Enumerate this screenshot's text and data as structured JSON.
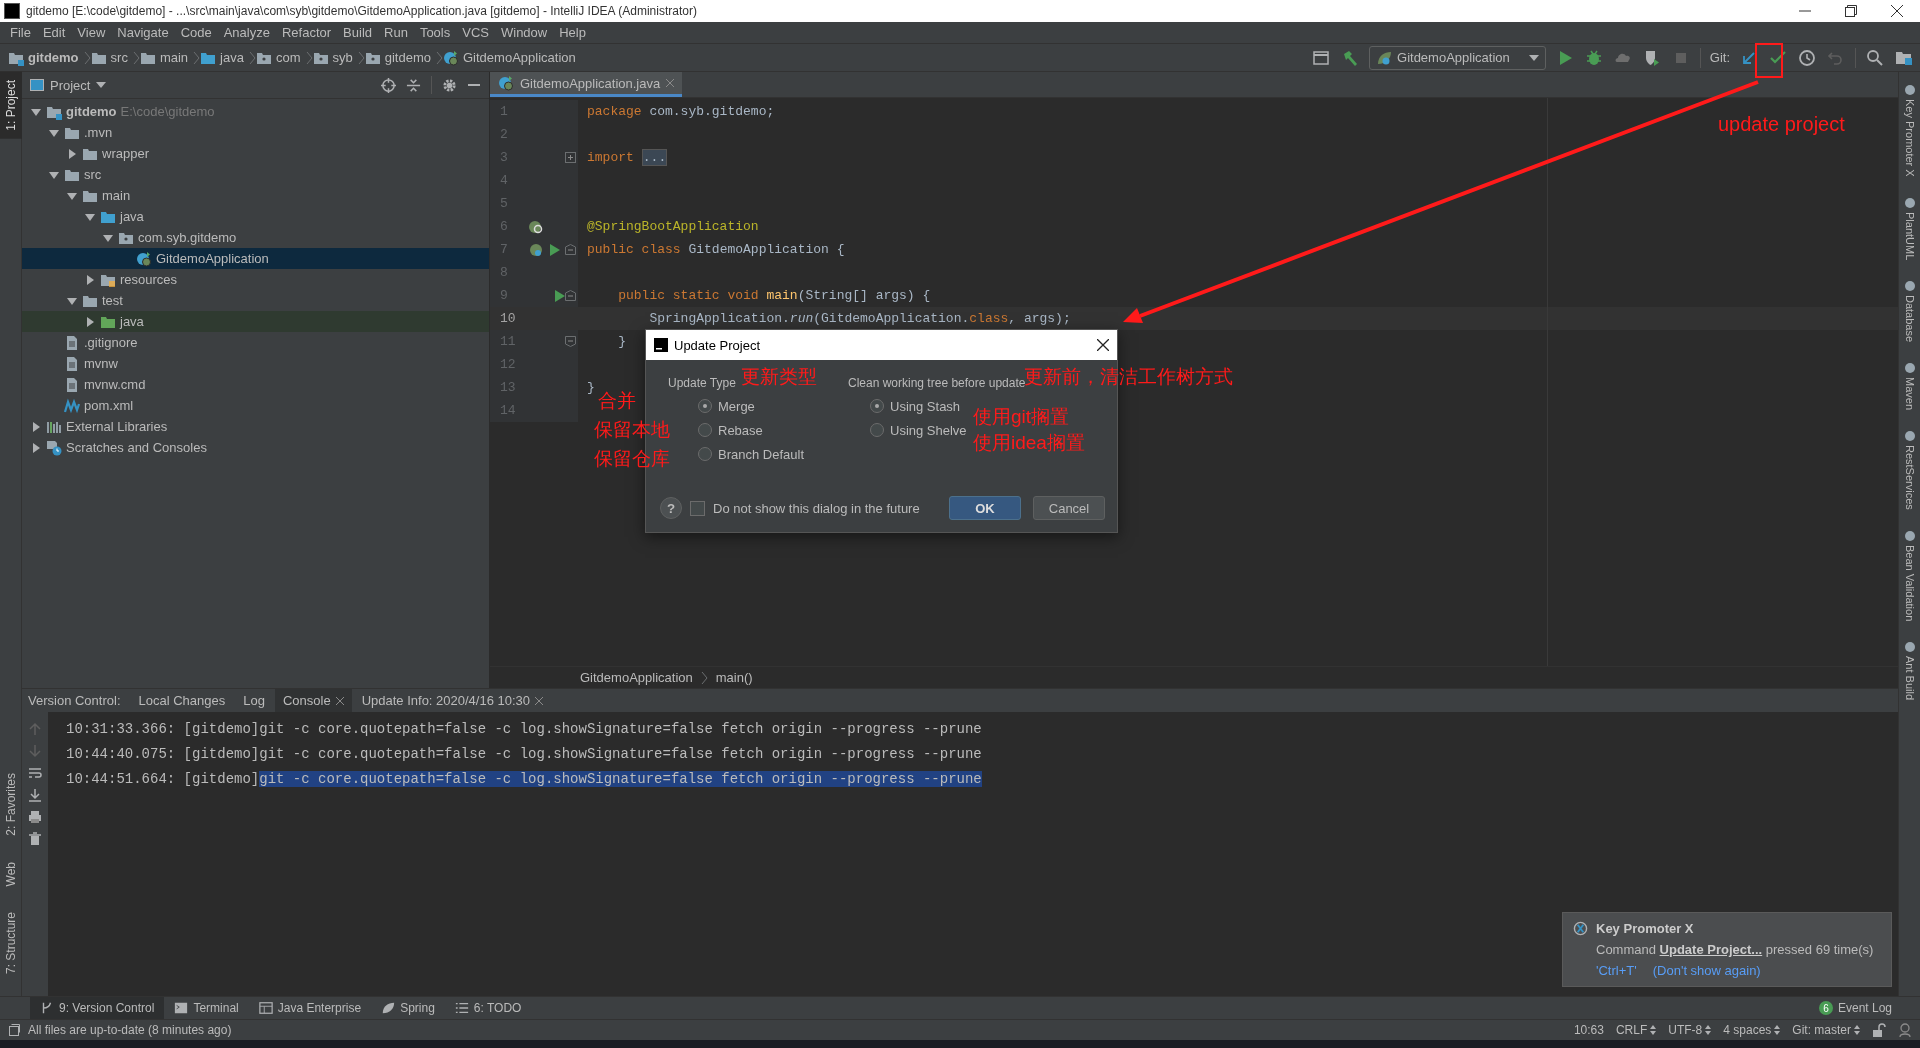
{
  "title_bar": {
    "title": "gitdemo [E:\\code\\gitdemo] - ...\\src\\main\\java\\com\\syb\\gitdemo\\GitdemoApplication.java [gitdemo] - IntelliJ IDEA (Administrator)"
  },
  "menu": [
    "File",
    "Edit",
    "View",
    "Navigate",
    "Code",
    "Analyze",
    "Refactor",
    "Build",
    "Run",
    "Tools",
    "VCS",
    "Window",
    "Help"
  ],
  "nav_bar": {
    "breadcrumbs": [
      {
        "label": "gitdemo",
        "kind": "module"
      },
      {
        "label": "src",
        "kind": "folder"
      },
      {
        "label": "main",
        "kind": "folder"
      },
      {
        "label": "java",
        "kind": "source-folder"
      },
      {
        "label": "com",
        "kind": "package"
      },
      {
        "label": "syb",
        "kind": "package"
      },
      {
        "label": "gitdemo",
        "kind": "package"
      },
      {
        "label": "GitdemoApplication",
        "kind": "spring-class"
      }
    ],
    "run_config": "GitdemoApplication",
    "vcs_label": "Git:"
  },
  "left_strip": [
    {
      "label": "1: Project",
      "selected": true
    },
    {
      "label": "2: Favorites",
      "selected": false
    },
    {
      "label": "Web",
      "selected": false
    },
    {
      "label": "7: Structure",
      "selected": false
    }
  ],
  "right_strip": [
    "Key Promoter X",
    "PlantUML",
    "Database",
    "Maven",
    "RestServices",
    "Bean Validation",
    "Ant Build"
  ],
  "project_panel": {
    "title": "Project",
    "tree": [
      {
        "label": "gitdemo",
        "kind": "module",
        "hint": "E:\\code\\gitdemo",
        "expanded": true,
        "selected": false,
        "children": [
          {
            "label": ".mvn",
            "kind": "folder",
            "expanded": true,
            "selected": false,
            "children": [
              {
                "label": "wrapper",
                "kind": "folder",
                "expanded": false,
                "selected": false
              }
            ]
          },
          {
            "label": "src",
            "kind": "folder",
            "expanded": true,
            "selected": false,
            "children": [
              {
                "label": "main",
                "kind": "folder",
                "expanded": true,
                "selected": false,
                "children": [
                  {
                    "label": "java",
                    "kind": "source-folder",
                    "expanded": true,
                    "selected": false,
                    "children": [
                      {
                        "label": "com.syb.gitdemo",
                        "kind": "package",
                        "expanded": true,
                        "selected": false,
                        "children": [
                          {
                            "label": "GitdemoApplication",
                            "kind": "spring-class",
                            "selected": true
                          }
                        ]
                      }
                    ]
                  },
                  {
                    "label": "resources",
                    "kind": "resources-folder",
                    "expanded": false,
                    "selected": false
                  }
                ]
              },
              {
                "label": "test",
                "kind": "folder",
                "expanded": true,
                "selected": false,
                "children": [
                  {
                    "label": "java",
                    "kind": "test-folder",
                    "expanded": false,
                    "selected": false
                  }
                ]
              }
            ]
          },
          {
            "label": ".gitignore",
            "kind": "file",
            "selected": false
          },
          {
            "label": "mvnw",
            "kind": "file",
            "selected": false
          },
          {
            "label": "mvnw.cmd",
            "kind": "file",
            "selected": false
          },
          {
            "label": "pom.xml",
            "kind": "maven",
            "selected": false
          }
        ]
      },
      {
        "label": "External Libraries",
        "kind": "libraries",
        "expanded": false,
        "selected": false
      },
      {
        "label": "Scratches and Consoles",
        "kind": "scratches",
        "expanded": false,
        "selected": false
      }
    ]
  },
  "editor": {
    "tabs": [
      {
        "label": "GitdemoApplication.java",
        "selected": true
      }
    ],
    "lines": [
      {
        "number": "1",
        "current": false,
        "tokens": [
          {
            "text": "package",
            "kind": "keyword"
          },
          {
            "text": " com.syb.gitdemo;",
            "kind": "plain"
          }
        ]
      },
      {
        "number": "2",
        "current": false
      },
      {
        "number": "3",
        "current": false,
        "fold": {
          "kind": "collapsed"
        },
        "tokens": [
          {
            "text": "import",
            "kind": "keyword"
          },
          {
            "text": "...",
            "kind": "folded"
          }
        ]
      },
      {
        "number": "4",
        "current": false
      },
      {
        "number": "5",
        "current": false
      },
      {
        "number": "6",
        "current": false,
        "gutter": {
          "kind": "spring"
        },
        "tokens": [
          {
            "text": "@SpringBootApplication",
            "kind": "annotation"
          }
        ]
      },
      {
        "number": "7",
        "current": false,
        "gutter": {
          "kind": "spring-run"
        },
        "fold": {
          "kind": "open"
        },
        "tokens": [
          {
            "text": "public class",
            "kind": "keyword"
          },
          {
            "text": " GitdemoApplication {",
            "kind": "plain"
          }
        ]
      },
      {
        "number": "8",
        "current": false
      },
      {
        "number": "9",
        "current": false,
        "gutter": {
          "kind": "run"
        },
        "fold": {
          "kind": "open"
        },
        "tokens": [
          {
            "text": "    public static void ",
            "kind": "keyword"
          },
          {
            "text": "main",
            "kind": "method"
          },
          {
            "text": "(String[] args) {",
            "kind": "plain"
          }
        ]
      },
      {
        "number": "10",
        "current": true,
        "tokens": [
          {
            "text": "        SpringApplication.",
            "kind": "plain"
          },
          {
            "text": "run",
            "kind": "static"
          },
          {
            "text": "(GitdemoApplication.",
            "kind": "plain"
          },
          {
            "text": "class",
            "kind": "keyword"
          },
          {
            "text": ", args);",
            "kind": "plain"
          }
        ]
      },
      {
        "number": "11",
        "current": false,
        "fold": {
          "kind": "end"
        },
        "tokens": [
          {
            "text": "    }",
            "kind": "plain"
          }
        ]
      },
      {
        "number": "12",
        "current": false
      },
      {
        "number": "13",
        "current": false,
        "tokens": [
          {
            "text": "}",
            "kind": "plain"
          }
        ]
      },
      {
        "number": "14",
        "current": false
      }
    ],
    "breadcrumbs": [
      "GitdemoApplication",
      "main()"
    ]
  },
  "bottom_panel": {
    "label": "Version Control:",
    "tabs": [
      {
        "label": "Local Changes",
        "selected": false,
        "closable": false
      },
      {
        "label": "Log",
        "selected": false,
        "closable": false
      },
      {
        "label": "Console",
        "selected": true,
        "closable": true
      },
      {
        "label": "Update Info: 2020/4/16 10:30",
        "selected": false,
        "closable": true
      }
    ],
    "console": [
      {
        "prefix": "10:31:33.366: [gitdemo]",
        "command": "git -c core.quotepath=false -c log.showSignature=false fetch origin --progress --prune",
        "selected": false
      },
      {
        "prefix": "10:44:40.075: [gitdemo]",
        "command": "git -c core.quotepath=false -c log.showSignature=false fetch origin --progress --prune",
        "selected": false
      },
      {
        "prefix": "10:44:51.664: [gitdemo]",
        "command": "git -c core.quotepath=false -c log.showSignature=false fetch origin --progress --prune",
        "selected": true
      }
    ]
  },
  "dialog": {
    "title": "Update Project",
    "groups": [
      {
        "label": "Update Type",
        "options": [
          {
            "label": "Merge",
            "selected": true
          },
          {
            "label": "Rebase",
            "selected": false
          },
          {
            "label": "Branch Default",
            "selected": false
          }
        ]
      },
      {
        "label": "Clean working tree before update",
        "options": [
          {
            "label": "Using Stash",
            "selected": true
          },
          {
            "label": "Using Shelve",
            "selected": false
          }
        ]
      }
    ],
    "help": "?",
    "checkbox": {
      "label": "Do not show this dialog in the future",
      "checked": false
    },
    "buttons": [
      {
        "label": "OK",
        "default": true
      },
      {
        "label": "Cancel",
        "default": false
      }
    ]
  },
  "annotations": [
    "update project",
    "更新类型",
    "更新前，清洁工作树方式",
    "合并",
    "保留本地",
    "保留仓库",
    "使用git搁置",
    "使用idea搁置"
  ],
  "notification": {
    "title": "Key Promoter X",
    "before": "Command",
    "link": "Update Project...",
    "after": "pressed 69 time(s)",
    "actions": [
      "'Ctrl+T'",
      "(Don't show again)"
    ]
  },
  "tool_window_bar": {
    "tabs": [
      {
        "label": "9: Version Control",
        "kind": "branch",
        "selected": true
      },
      {
        "label": "Terminal",
        "kind": "terminal",
        "selected": false
      },
      {
        "label": "Java Enterprise",
        "kind": "enterprise",
        "selected": false
      },
      {
        "label": "Spring",
        "kind": "leaf",
        "selected": false
      },
      {
        "label": "6: TODO",
        "kind": "list",
        "selected": false
      }
    ],
    "event_log": {
      "label": "Event Log",
      "count": "6"
    }
  },
  "status_bar": {
    "message": "All files are up-to-date (8 minutes ago)",
    "items": [
      {
        "label": "10:63",
        "switch": false
      },
      {
        "label": "CRLF",
        "switch": true
      },
      {
        "label": "UTF-8",
        "switch": true
      },
      {
        "label": "4 spaces",
        "switch": true
      },
      {
        "label": "Git: master",
        "switch": true
      }
    ]
  }
}
